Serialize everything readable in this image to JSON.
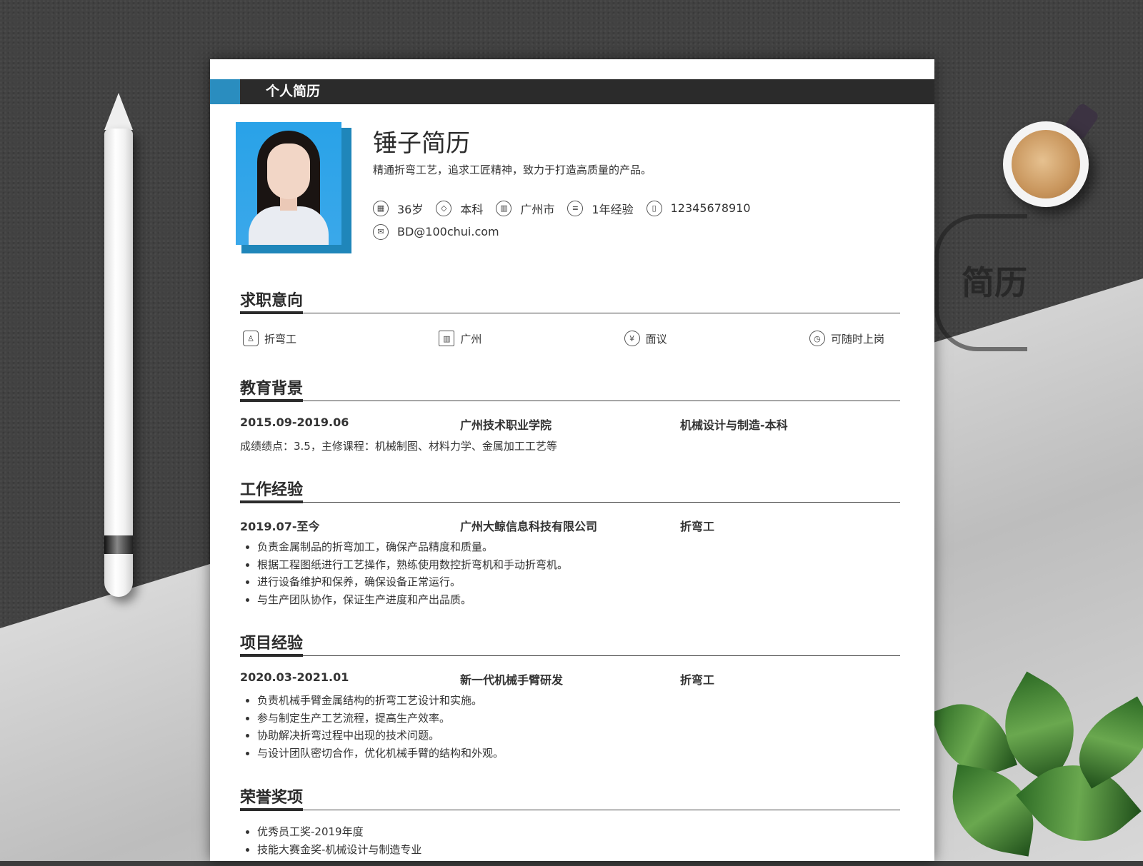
{
  "header": {
    "label": "个人简历"
  },
  "profile": {
    "name": "锤子简历",
    "tagline": "精通折弯工艺，追求工匠精神，致力于打造高质量的产品。",
    "age": "36岁",
    "education": "本科",
    "city": "广州市",
    "experience": "1年经验",
    "phone": "12345678910",
    "email": "BD@100chui.com"
  },
  "intent": {
    "title": "求职意向",
    "position": "折弯工",
    "location": "广州",
    "salary": "面议",
    "availability": "可随时上岗"
  },
  "education": {
    "title": "教育背景",
    "period": "2015.09-2019.06",
    "school": "广州技术职业学院",
    "major": "机械设计与制造-本科",
    "detail": "成绩绩点：3.5，主修课程：机械制图、材料力学、金属加工工艺等"
  },
  "work": {
    "title": "工作经验",
    "period": "2019.07-至今",
    "company": "广州大鲸信息科技有限公司",
    "role": "折弯工",
    "items": [
      "负责金属制品的折弯加工，确保产品精度和质量。",
      "根据工程图纸进行工艺操作，熟练使用数控折弯机和手动折弯机。",
      "进行设备维护和保养，确保设备正常运行。",
      "与生产团队协作，保证生产进度和产出品质。"
    ]
  },
  "project": {
    "title": "项目经验",
    "period": "2020.03-2021.01",
    "name": "新一代机械手臂研发",
    "role": "折弯工",
    "items": [
      "负责机械手臂金属结构的折弯工艺设计和实施。",
      "参与制定生产工艺流程，提高生产效率。",
      "协助解决折弯过程中出现的技术问题。",
      "与设计团队密切合作，优化机械手臂的结构和外观。"
    ]
  },
  "honors": {
    "title": "荣誉奖项",
    "items": [
      "优秀员工奖-2019年度",
      "技能大赛金奖-机械设计与制造专业"
    ]
  },
  "decor": {
    "stamp_text": "简历"
  },
  "colors": {
    "accent": "#2a8dbf",
    "bar": "#2b2b2b"
  }
}
